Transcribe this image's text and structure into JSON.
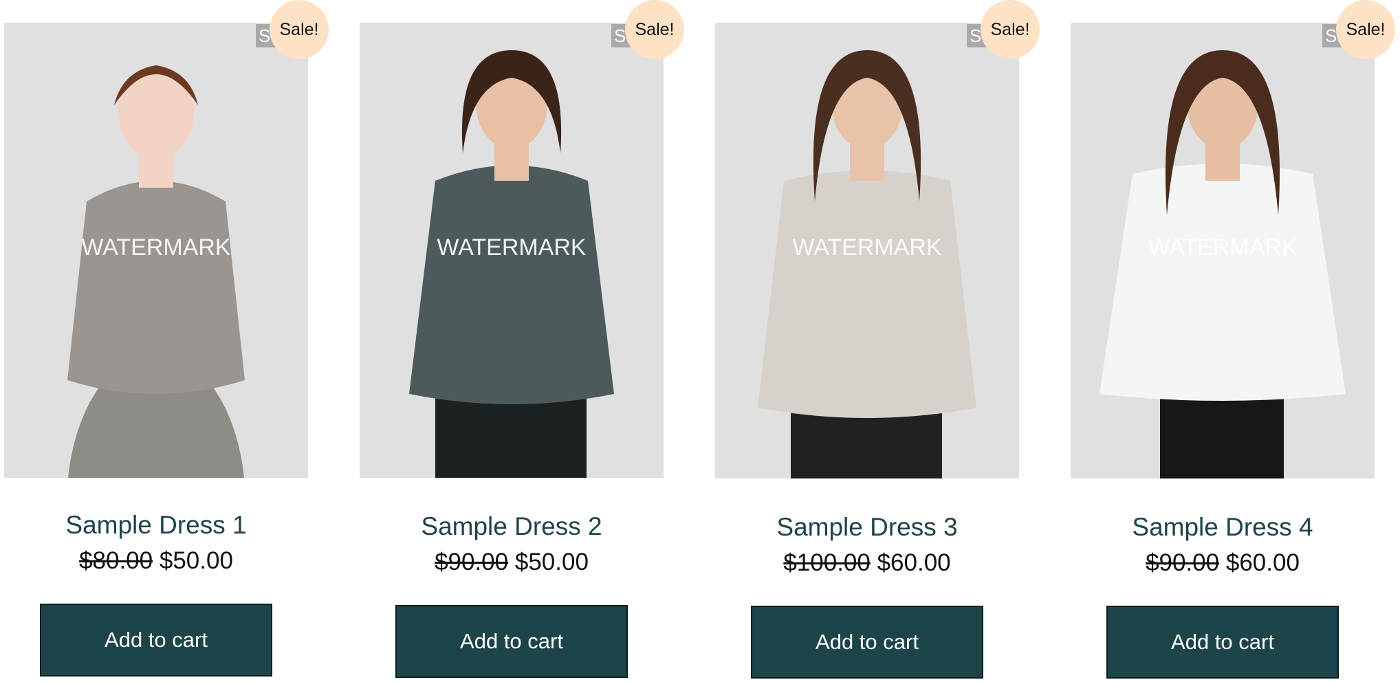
{
  "colors": {
    "accent": "#1d4449",
    "sale_badge": "#fde2c5",
    "photo_bg": "#e0e0e0"
  },
  "products": [
    {
      "title": "Sample Dress 1",
      "old_price": "$80.00",
      "price": "$50.00",
      "badge": "Sale!",
      "sku_label": "SK",
      "watermark": "WATERMARK",
      "button": "Add to cart",
      "top_color": "#9a9590",
      "bottom_color": "#8f8b87",
      "skin": "#f2d3c4",
      "hair": "#6b3a22"
    },
    {
      "title": "Sample Dress 2",
      "old_price": "$90.00",
      "price": "$50.00",
      "badge": "Sale!",
      "sku_label": "SK",
      "watermark": "WATERMARK",
      "button": "Add to cart",
      "top_color": "#4d5a5b",
      "bottom_color": "#1b2221",
      "skin": "#e8c0a6",
      "hair": "#3a2418"
    },
    {
      "title": "Sample Dress 3",
      "old_price": "$100.00",
      "price": "$60.00",
      "badge": "Sale!",
      "sku_label": "SK",
      "watermark": "WATERMARK",
      "button": "Add to cart",
      "top_color": "#d7d1cc",
      "bottom_color": "#1e2322",
      "skin": "#e9c3a9",
      "hair": "#4a2e20"
    },
    {
      "title": "Sample Dress 4",
      "old_price": "$90.00",
      "price": "$60.00",
      "badge": "Sale!",
      "sku_label": "SK",
      "watermark": "WATERMARK",
      "button": "Add to cart",
      "top_color": "#f4f6f6",
      "bottom_color": "#141817",
      "skin": "#e6bea2",
      "hair": "#4a2c1c"
    }
  ]
}
